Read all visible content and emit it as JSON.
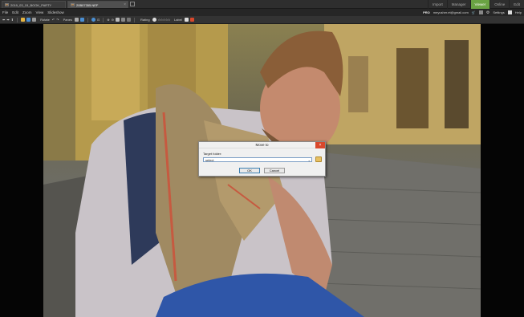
{
  "tabs": [
    {
      "label": "2019_03_15_BOOK_PARTY"
    },
    {
      "label": "20B07355.NEF",
      "active": true
    }
  ],
  "modes": [
    "Import",
    "Manager",
    "Viewer",
    "Online",
    "Edit"
  ],
  "active_mode": "Viewer",
  "menu": [
    "File",
    "Edit",
    "Zoom",
    "View",
    "Slideshow"
  ],
  "account": {
    "badge": "PRO",
    "email": "meyusher.et@gmail.com",
    "settings_label": "Settings",
    "help_label": "Help"
  },
  "toolbar": {
    "rotate_label": "Rotate",
    "panes_label": "Panes",
    "rating_label": "Rating",
    "rating_stars": "☆☆☆☆☆",
    "label_label": "Label"
  },
  "dialog": {
    "title": "Move to",
    "field_label": "Target folder:",
    "field_value": "select",
    "ok_label": "OK",
    "cancel_label": "Cancel"
  },
  "colors": {
    "accent_active_mode": "#6aa343",
    "close_button": "#d9482c"
  }
}
